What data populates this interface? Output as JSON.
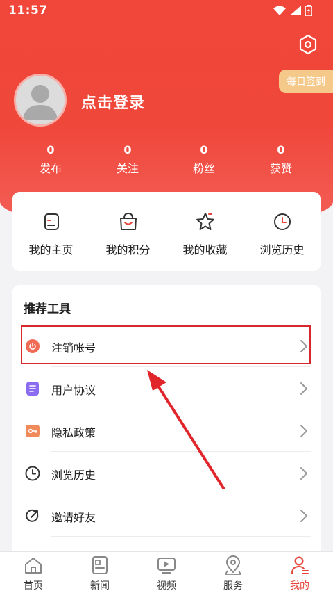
{
  "status_bar": {
    "time": "11:57"
  },
  "profile": {
    "login_prompt": "点击登录",
    "daily_checkin": "每日签到"
  },
  "stats": [
    {
      "value": "0",
      "label": "发布"
    },
    {
      "value": "0",
      "label": "关注"
    },
    {
      "value": "0",
      "label": "粉丝"
    },
    {
      "value": "0",
      "label": "获赞"
    }
  ],
  "quick_links": [
    {
      "label": "我的主页",
      "icon": "profile-page-icon"
    },
    {
      "label": "我的积分",
      "icon": "shopping-bag-icon"
    },
    {
      "label": "我的收藏",
      "icon": "star-icon"
    },
    {
      "label": "浏览历史",
      "icon": "clock-icon"
    }
  ],
  "tools": {
    "title": "推荐工具",
    "items": [
      {
        "label": "注销帐号",
        "icon": "power-icon",
        "color": "#f06a55"
      },
      {
        "label": "用户协议",
        "icon": "document-icon",
        "color": "#8b6cf0"
      },
      {
        "label": "隐私政策",
        "icon": "key-icon",
        "color": "#f08a5a"
      },
      {
        "label": "浏览历史",
        "icon": "clock-icon",
        "color": "#333333"
      },
      {
        "label": "邀请好友",
        "icon": "share-icon",
        "color": "#333333"
      }
    ]
  },
  "bottom_nav": [
    {
      "label": "首页",
      "icon": "home-icon",
      "active": false
    },
    {
      "label": "新闻",
      "icon": "news-icon",
      "active": false
    },
    {
      "label": "视频",
      "icon": "video-icon",
      "active": false
    },
    {
      "label": "服务",
      "icon": "location-icon",
      "active": false
    },
    {
      "label": "我的",
      "icon": "user-icon",
      "active": true
    }
  ],
  "colors": {
    "brand": "#f0473b",
    "accent": "#e8453c",
    "badge": "#f5c98a",
    "highlight": "#d7282e"
  }
}
